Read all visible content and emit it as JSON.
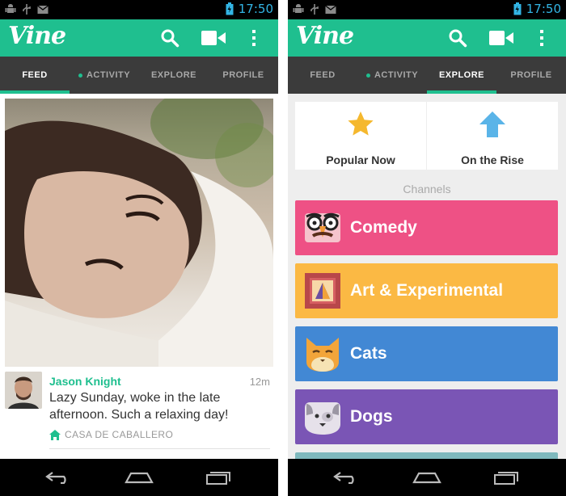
{
  "status_bar": {
    "time": "17:50"
  },
  "app": {
    "logo": "Vine"
  },
  "left_screen": {
    "tabs": [
      {
        "label": "FEED",
        "active": true,
        "dot": false
      },
      {
        "label": "ACTIVITY",
        "active": false,
        "dot": true
      },
      {
        "label": "EXPLORE",
        "active": false,
        "dot": false
      },
      {
        "label": "PROFILE",
        "active": false,
        "dot": false
      }
    ],
    "post": {
      "username": "Jason Knight",
      "time_ago": "12m",
      "caption": "Lazy Sunday, woke in the late afternoon. Such a relaxing day!",
      "location": "CASA DE CABALLERO"
    }
  },
  "right_screen": {
    "tabs": [
      {
        "label": "FEED",
        "active": false,
        "dot": false
      },
      {
        "label": "ACTIVITY",
        "active": false,
        "dot": true
      },
      {
        "label": "EXPLORE",
        "active": true,
        "dot": false
      },
      {
        "label": "PROFILE",
        "active": false,
        "dot": false
      }
    ],
    "features": [
      {
        "label": "Popular Now",
        "icon": "star-icon",
        "color": "#f5b82e"
      },
      {
        "label": "On the Rise",
        "icon": "arrow-up-icon",
        "color": "#5ab4e8"
      }
    ],
    "channels_heading": "Channels",
    "channels": [
      {
        "label": "Comedy",
        "icon": "comedy-glasses-icon",
        "color": "#ee5185"
      },
      {
        "label": "Art & Experimental",
        "icon": "art-frame-icon",
        "color": "#fbb944"
      },
      {
        "label": "Cats",
        "icon": "cat-icon",
        "color": "#4288d4"
      },
      {
        "label": "Dogs",
        "icon": "dog-icon",
        "color": "#7a55b5"
      }
    ]
  },
  "colors": {
    "brand": "#1fbf8f",
    "tab_bar": "#3b3b3b",
    "status_accent": "#33b5e5"
  }
}
